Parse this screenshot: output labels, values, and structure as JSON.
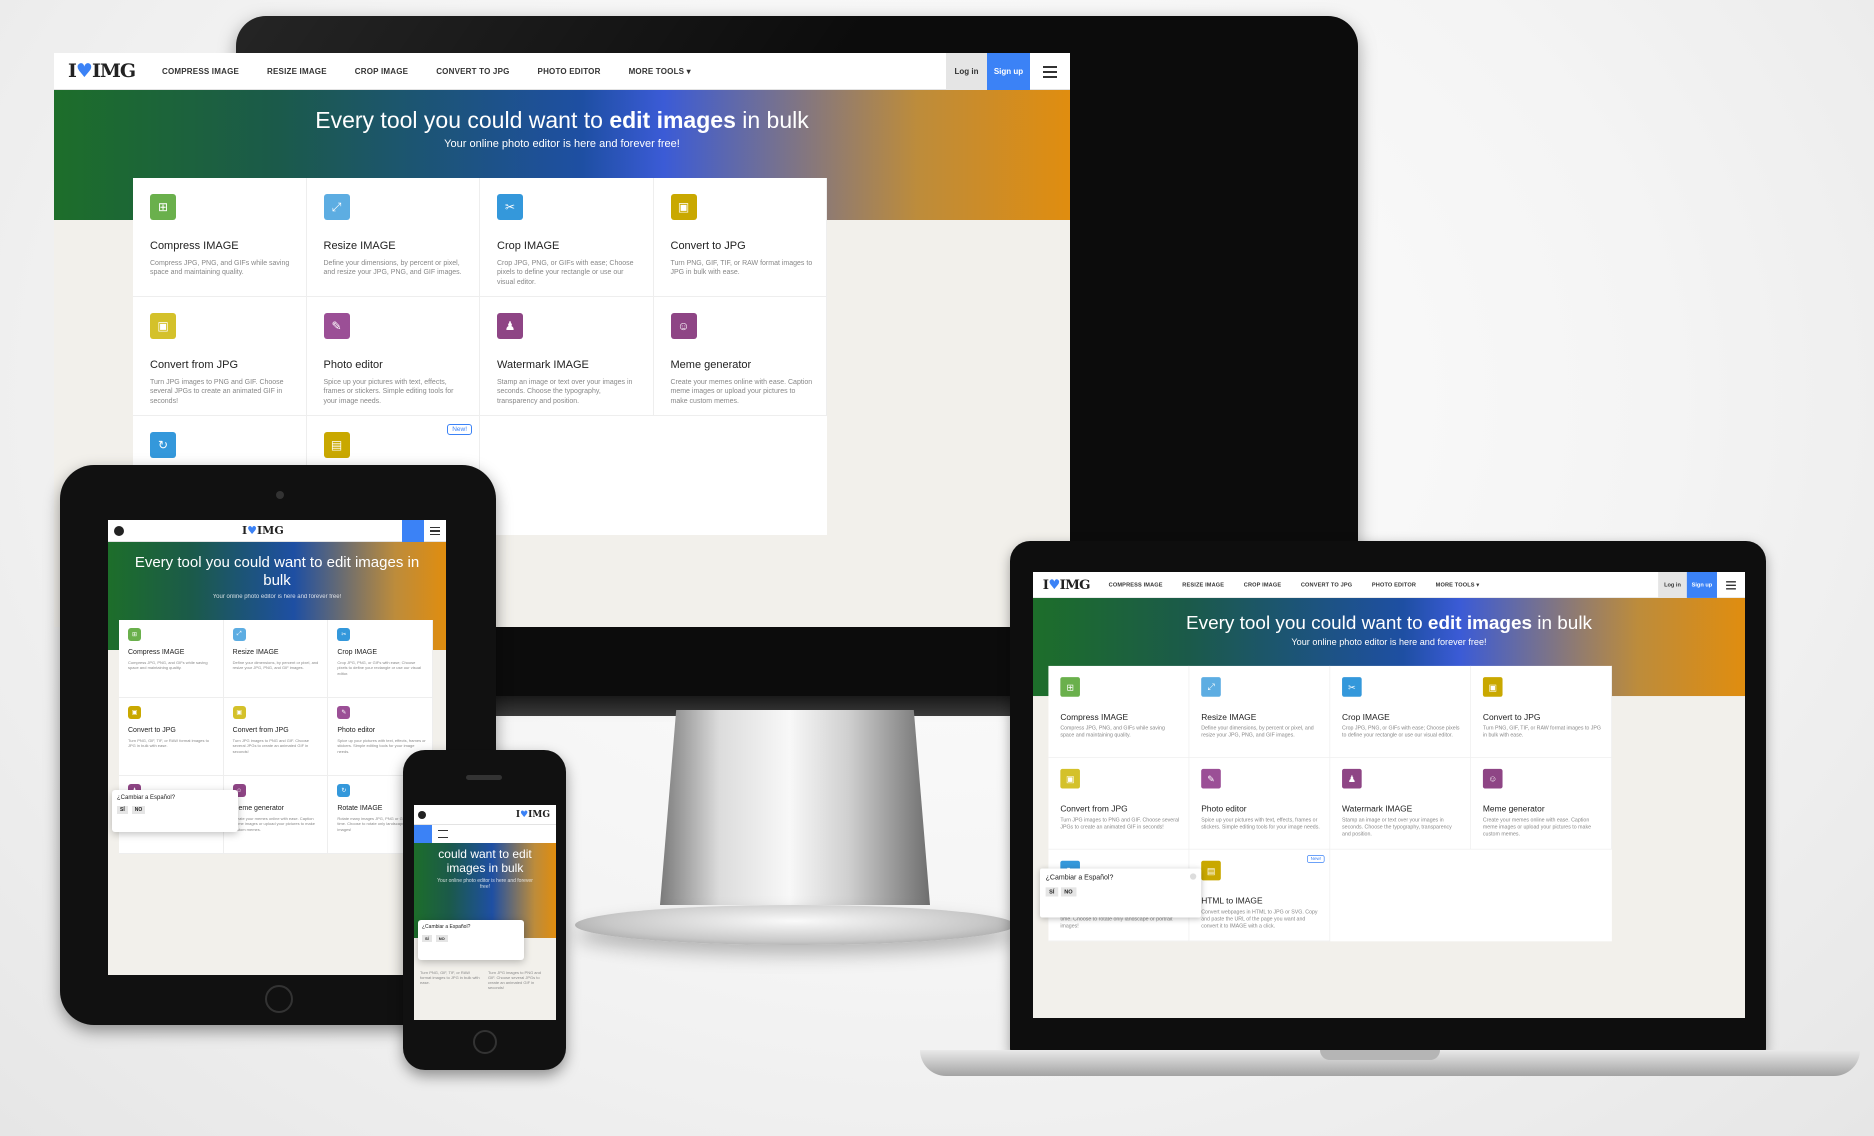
{
  "site": {
    "logo_left": "I",
    "logo_heart": "♥",
    "logo_right": "IMG",
    "nav": [
      "COMPRESS IMAGE",
      "RESIZE IMAGE",
      "CROP IMAGE",
      "CONVERT TO JPG",
      "PHOTO EDITOR",
      "MORE TOOLS ▾"
    ],
    "login": "Log in",
    "signup": "Sign up",
    "hero_title_a": "Every tool you could want to ",
    "hero_title_b": "edit images",
    "hero_title_c": " in bulk",
    "hero_sub": "Your online photo editor is here and forever free!",
    "new_badge": "New!",
    "accent": "#3b82f6"
  },
  "tools": [
    {
      "title": "Compress IMAGE",
      "desc": "Compress JPG, PNG, and GIFs while saving space and maintaining quality.",
      "icon": "compress-icon",
      "color": "#6ab04c"
    },
    {
      "title": "Resize IMAGE",
      "desc": "Define your dimensions, by percent or pixel, and resize your JPG, PNG, and GIF images.",
      "icon": "resize-icon",
      "color": "#5dade2"
    },
    {
      "title": "Crop IMAGE",
      "desc": "Crop JPG, PNG, or GIFs with ease; Choose pixels to define your rectangle or use our visual editor.",
      "icon": "crop-icon",
      "color": "#3498db"
    },
    {
      "title": "Convert to JPG",
      "desc": "Turn PNG, GIF, TIF, or RAW format images to JPG in bulk with ease.",
      "icon": "convert-to-jpg-icon",
      "color": "#c9a800"
    },
    {
      "title": "Convert from JPG",
      "desc": "Turn JPG images to PNG and GIF. Choose several JPGs to create an animated GIF in seconds!",
      "icon": "convert-from-jpg-icon",
      "color": "#d4c12a"
    },
    {
      "title": "Photo editor",
      "desc": "Spice up your pictures with text, effects, frames or stickers. Simple editing tools for your image needs.",
      "icon": "pencil-icon",
      "color": "#9b4f96"
    },
    {
      "title": "Watermark IMAGE",
      "desc": "Stamp an image or text over your images in seconds. Choose the typography, transparency and position.",
      "icon": "stamp-icon",
      "color": "#8e4585"
    },
    {
      "title": "Meme generator",
      "desc": "Create your memes online with ease. Caption meme images or upload your pictures to make custom memes.",
      "icon": "smile-icon",
      "color": "#8e4585"
    },
    {
      "title": "Rotate IMAGE",
      "desc": "Rotate many images JPG, PNG or GIF at same time. Choose to rotate only landscape or portrait images!",
      "icon": "rotate-icon",
      "color": "#3498db"
    },
    {
      "title": "HTML to IMAGE",
      "desc": "Convert webpages in HTML to JPG or SVG. Copy and paste the URL of the page you want and convert it to IMAGE with a click.",
      "icon": "html-icon",
      "color": "#c9a800"
    }
  ],
  "popup": {
    "question": "¿Cambiar a Español?",
    "yes": "SÍ",
    "no": "NO"
  },
  "mobile": {
    "hero_title_phone": "could want to edit images in bulk"
  }
}
